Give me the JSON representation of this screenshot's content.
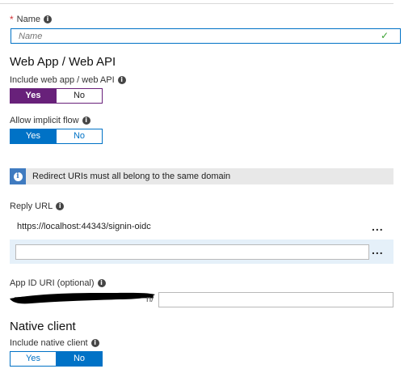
{
  "name_field": {
    "label": "Name",
    "required_mark": "*",
    "placeholder": "Name",
    "value": "",
    "valid_mark": "✓"
  },
  "web_app": {
    "heading": "Web App / Web API",
    "include_label": "Include web app / web API",
    "include_toggle": {
      "yes": "Yes",
      "no": "No",
      "selected": "Yes"
    },
    "implicit_label": "Allow implicit flow",
    "implicit_toggle": {
      "yes": "Yes",
      "no": "No",
      "selected": "Yes"
    }
  },
  "banner": {
    "icon": "i",
    "text": "Redirect URIs must all belong to the same domain"
  },
  "reply_url": {
    "label": "Reply URL",
    "existing_value": "https://localhost:44343/signin-oidc",
    "more_label": "...",
    "new_value": "",
    "new_more_label": "..."
  },
  "app_id_uri": {
    "label": "App ID URI (optional)",
    "suffix_text": "n/",
    "value": ""
  },
  "native_client": {
    "heading": "Native client",
    "include_label": "Include native client",
    "include_toggle": {
      "yes": "Yes",
      "no": "No",
      "selected": "No"
    }
  },
  "info_icon_glyph": "i",
  "colors": {
    "accent_blue": "#0072c6",
    "accent_purple": "#68217a",
    "required_red": "#d13438",
    "valid_green": "#3aa232"
  }
}
